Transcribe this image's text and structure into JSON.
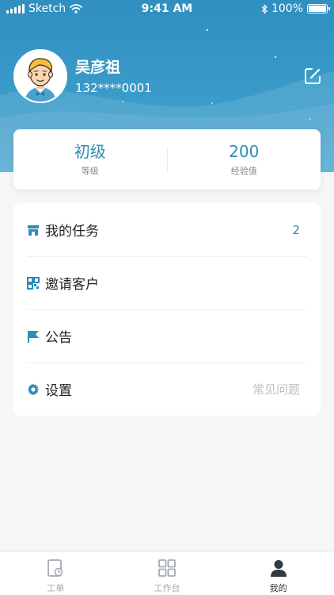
{
  "colors": {
    "accent": "#2c8db8",
    "header_top": "#2f8fc0",
    "header_bottom": "#4aa6d0",
    "tab_inactive": "#a5abb1",
    "tab_active": "#333333"
  },
  "status_bar": {
    "carrier": "Sketch",
    "time": "9:41 AM",
    "battery": "100%",
    "icons": [
      "signal-icon",
      "wifi-icon",
      "bluetooth-icon",
      "battery-icon"
    ]
  },
  "profile": {
    "name": "吴彦祖",
    "phone": "132****0001",
    "avatar_icon": "avatar-cartoon-man",
    "edit_icon": "edit-icon"
  },
  "stats": [
    {
      "value": "初级",
      "label": "等级"
    },
    {
      "value": "200",
      "label": "经验值"
    }
  ],
  "menu": [
    {
      "icon": "store-icon",
      "label": "我的任务",
      "badge": "2",
      "hint": ""
    },
    {
      "icon": "qrcode-icon",
      "label": "邀请客户",
      "badge": "",
      "hint": ""
    },
    {
      "icon": "flag-icon",
      "label": "公告",
      "badge": "",
      "hint": ""
    },
    {
      "icon": "gear-icon",
      "label": "设置",
      "badge": "",
      "hint": "常见问题"
    }
  ],
  "tabs": [
    {
      "icon": "work-order-icon",
      "label": "工单",
      "active": false
    },
    {
      "icon": "workbench-grid-icon",
      "label": "工作台",
      "active": false
    },
    {
      "icon": "person-icon",
      "label": "我的",
      "active": true
    }
  ]
}
